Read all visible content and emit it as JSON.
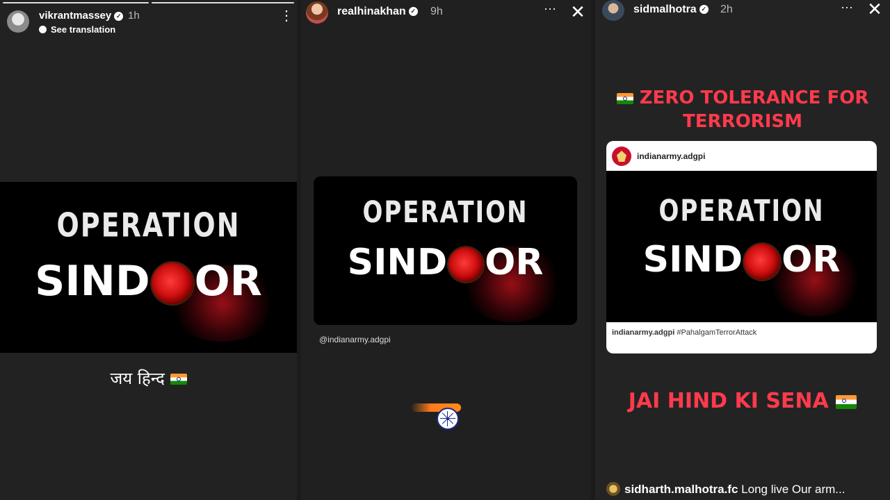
{
  "story1": {
    "username": "vikrantmassey",
    "time": "1h",
    "translation": "See translation",
    "poster": {
      "line1": "OPERATION",
      "line2_left": "SIND",
      "line2_right": "OR"
    },
    "caption": "जय हिन्द"
  },
  "story2": {
    "username": "realhinakhan",
    "time": "9h",
    "poster": {
      "line1": "OPERATION",
      "line2_left": "SIND",
      "line2_right": "OR"
    },
    "mention": "@indianarmy.adgpi"
  },
  "story3": {
    "username": "sidmalhotra",
    "time": "2h",
    "headline_line1": "ZERO TOLERANCE FOR",
    "headline_line2": "TERRORISM",
    "card": {
      "account": "indianarmy.adgpi",
      "poster": {
        "line1": "OPERATION",
        "line2_left": "SIND",
        "line2_right": "OR"
      },
      "caption_user": "indianarmy.adgpi",
      "caption_tag": "#PahalgamTerrorAttack"
    },
    "footer_text": "JAI HIND KI SENA",
    "comment_user": "sidharth.malhotra.fc",
    "comment_text": "Long live Our arm..."
  },
  "icons": {
    "verified": "verified-badge-icon",
    "more": "more-icon",
    "close": "close-icon",
    "translate": "translate-icon",
    "flag": "india-flag-icon",
    "chakra": "ashoka-chakra-icon"
  }
}
